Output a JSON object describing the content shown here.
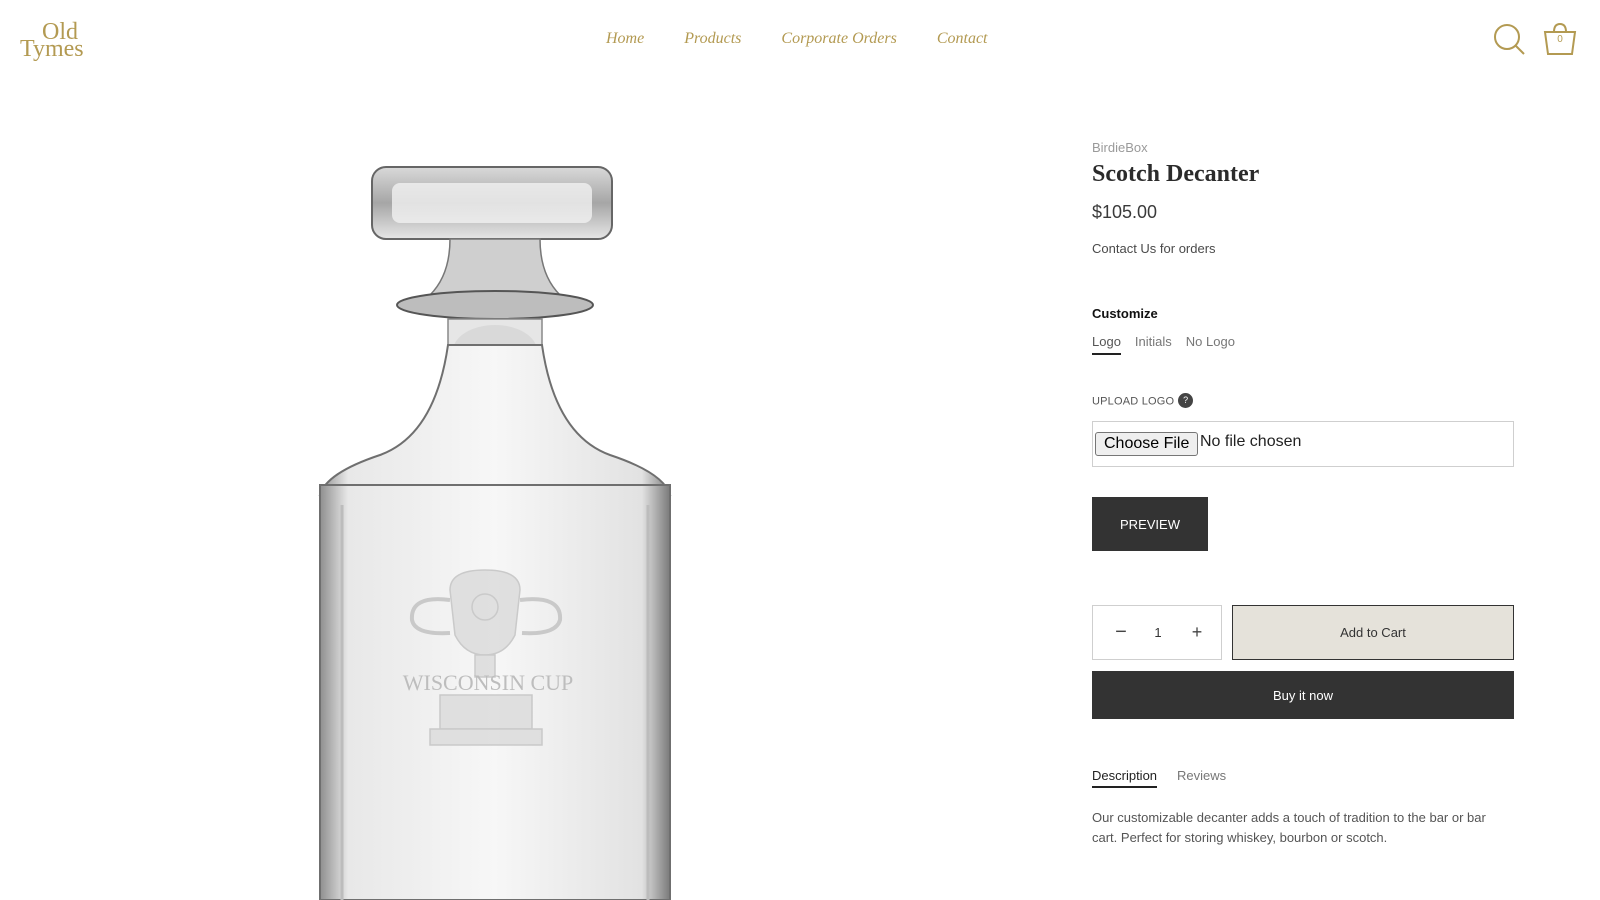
{
  "header": {
    "logo_line1": "Old",
    "logo_line2": "Tymes",
    "nav": [
      "Home",
      "Products",
      "Corporate Orders",
      "Contact"
    ],
    "cart_count": "0"
  },
  "product": {
    "vendor": "BirdieBox",
    "title": "Scotch Decanter",
    "price": "$105.00",
    "contact_note": "Contact Us for orders",
    "image_engraving": "WISCONSIN CUP"
  },
  "customize": {
    "label": "Customize",
    "options": [
      "Logo",
      "Initials",
      "No Logo"
    ],
    "selected": "Logo"
  },
  "upload": {
    "label": "UPLOAD LOGO",
    "help_symbol": "?",
    "choose_button": "Choose File",
    "status": "No file chosen"
  },
  "actions": {
    "preview": "PREVIEW",
    "quantity": "1",
    "minus": "−",
    "plus": "+",
    "add_to_cart": "Add to Cart",
    "buy_now": "Buy it now"
  },
  "tabs": {
    "items": [
      "Description",
      "Reviews"
    ],
    "active": "Description",
    "description": "Our customizable decanter adds a touch of tradition to the bar or bar cart. Perfect for storing whiskey, bourbon or scotch."
  },
  "colors": {
    "accent_gold": "#b39a52",
    "dark_button": "#333333",
    "add_cart_bg": "#e5e2da"
  },
  "icons": [
    "search-icon",
    "cart-icon",
    "help-icon",
    "minus-icon",
    "plus-icon"
  ]
}
